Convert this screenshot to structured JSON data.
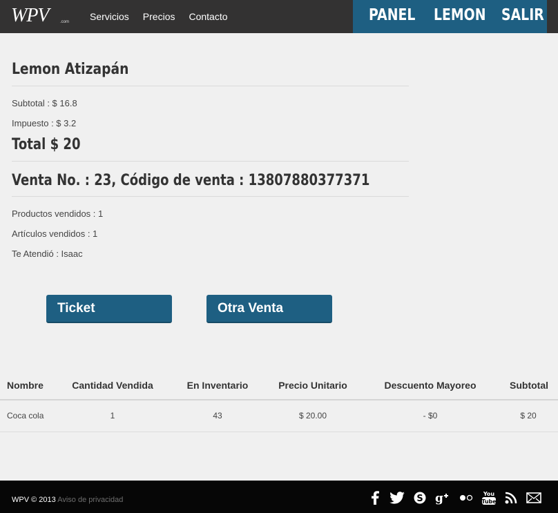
{
  "navbar": {
    "logo_text": "WPV",
    "logo_sub": ".com",
    "links": [
      "Servicios",
      "Precios",
      "Contacto"
    ],
    "right_buttons": [
      "PANEL",
      "LEMON",
      "SALIR"
    ]
  },
  "summary": {
    "store_name": "Lemon Atizapán",
    "subtotal": "Subtotal : $ 16.8",
    "impuesto": "Impuesto : $ 3.2",
    "total": "Total $ 20",
    "venta_line": "Venta No. : 23, Código de venta : 13807880377371",
    "productos": "Productos vendidos : 1",
    "articulos": "Artículos vendidos : 1",
    "atendio": "Te Atendió : Isaac"
  },
  "actions": {
    "ticket": "Ticket",
    "otra_venta": "Otra Venta"
  },
  "table": {
    "headers": [
      "Nombre",
      "Cantidad Vendida",
      "En Inventario",
      "Precio Unitario",
      "Descuento Mayoreo",
      "Subtotal"
    ],
    "rows": [
      [
        "Coca cola",
        "1",
        "43",
        "$ 20.00",
        "- $0",
        "$ 20"
      ]
    ]
  },
  "footer": {
    "copyright": "WPV © 2013",
    "privacy_link": "Aviso de privacidad",
    "social_icons": [
      "facebook-icon",
      "twitter-icon",
      "skype-icon",
      "google-plus-icon",
      "flickr-icon",
      "youtube-icon",
      "rss-icon",
      "email-icon"
    ]
  },
  "colors": {
    "nav_bg": "#333232",
    "accent": "#1e5f82",
    "footer_bg": "#060606",
    "page_bg": "#f0f0f0"
  }
}
